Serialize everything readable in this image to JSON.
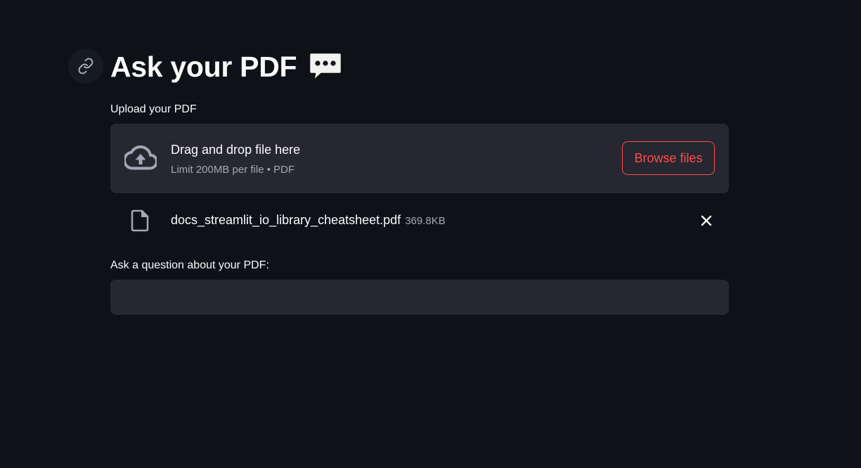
{
  "header": {
    "title": "Ask your PDF",
    "title_icon": "speech-balloon-icon",
    "anchor_icon": "link-icon"
  },
  "uploader": {
    "label": "Upload your PDF",
    "drop_title": "Drag and drop file here",
    "limit_text": "Limit 200MB per file • PDF",
    "browse_label": "Browse files",
    "icon": "cloud-upload-icon"
  },
  "uploaded_file": {
    "name": "docs_streamlit_io_library_cheatsheet.pdf",
    "size": "369.8KB",
    "icon": "file-icon",
    "remove_icon": "close-icon"
  },
  "question": {
    "label": "Ask a question about your PDF:",
    "value": ""
  },
  "colors": {
    "background": "#0e1117",
    "surface": "#262730",
    "accent": "#ff4b4b",
    "text": "#fafafa",
    "muted_text": "#a3a8b8"
  }
}
